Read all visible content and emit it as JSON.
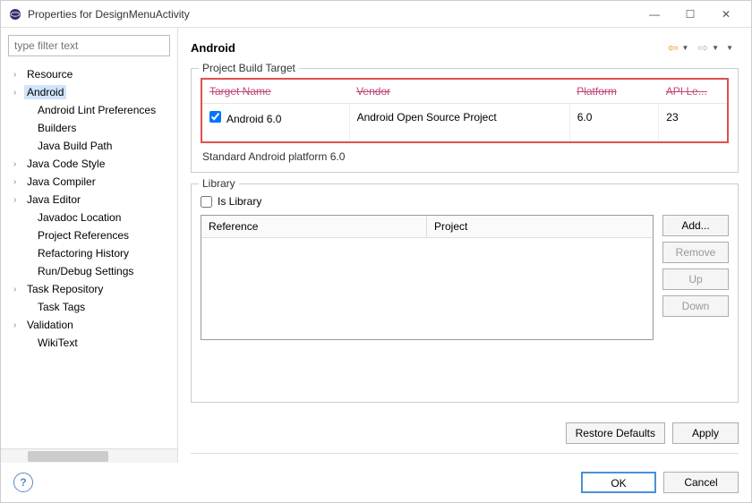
{
  "window": {
    "title": "Properties for DesignMenuActivity"
  },
  "filter": {
    "placeholder": "type filter text"
  },
  "tree": [
    {
      "label": "Resource",
      "expandable": true,
      "selected": false
    },
    {
      "label": "Android",
      "expandable": true,
      "selected": true
    },
    {
      "label": "Android Lint Preferences",
      "expandable": false,
      "child": true
    },
    {
      "label": "Builders",
      "expandable": false,
      "child": true
    },
    {
      "label": "Java Build Path",
      "expandable": false,
      "child": true
    },
    {
      "label": "Java Code Style",
      "expandable": true,
      "child": false
    },
    {
      "label": "Java Compiler",
      "expandable": true,
      "child": false
    },
    {
      "label": "Java Editor",
      "expandable": true,
      "child": false
    },
    {
      "label": "Javadoc Location",
      "expandable": false,
      "child": true
    },
    {
      "label": "Project References",
      "expandable": false,
      "child": true
    },
    {
      "label": "Refactoring History",
      "expandable": false,
      "child": true
    },
    {
      "label": "Run/Debug Settings",
      "expandable": false,
      "child": true
    },
    {
      "label": "Task Repository",
      "expandable": true,
      "child": false
    },
    {
      "label": "Task Tags",
      "expandable": false,
      "child": true
    },
    {
      "label": "Validation",
      "expandable": true,
      "child": false
    },
    {
      "label": "WikiText",
      "expandable": false,
      "child": true
    }
  ],
  "page": {
    "heading": "Android",
    "buildTarget": {
      "group": "Project Build Target",
      "cols": {
        "name": "Target Name",
        "vendor": "Vendor",
        "platform": "Platform",
        "api": "API Le..."
      },
      "row": {
        "checked": true,
        "name": "Android 6.0",
        "vendor": "Android Open Source Project",
        "platform": "6.0",
        "api": "23"
      },
      "note": "Standard Android platform 6.0"
    },
    "library": {
      "group": "Library",
      "isLibrary": "Is Library",
      "cols": {
        "reference": "Reference",
        "project": "Project"
      },
      "btns": {
        "add": "Add...",
        "remove": "Remove",
        "up": "Up",
        "down": "Down"
      }
    }
  },
  "buttons": {
    "restore": "Restore Defaults",
    "apply": "Apply",
    "ok": "OK",
    "cancel": "Cancel"
  }
}
